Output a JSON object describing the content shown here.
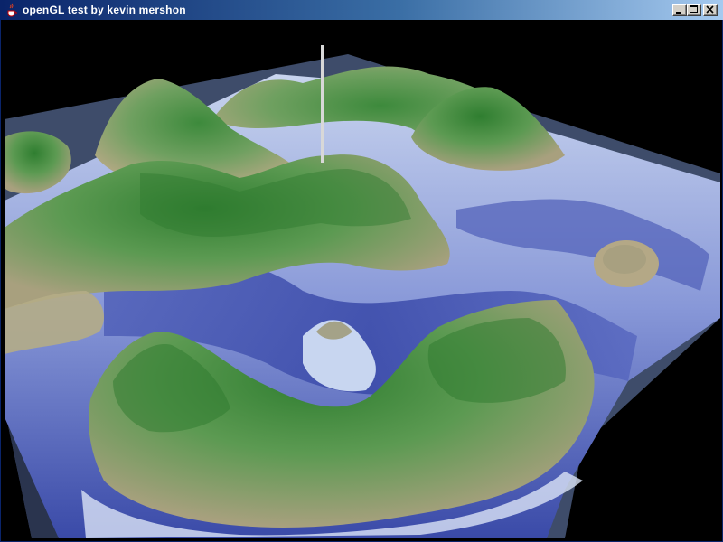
{
  "window": {
    "title": "openGL test by kevin mershon",
    "icon": "java-cup-icon",
    "controls": [
      "minimize-icon",
      "maximize-icon",
      "close-icon"
    ]
  },
  "scene": {
    "description_icon": "terrain-render",
    "colors": {
      "background": "#000000",
      "water_deep": "#3b4fb0",
      "water_shallow": "#b8c8f0",
      "land_low": "#a8a888",
      "land_high": "#3c8a3c",
      "table_edge": "#4a5a7a"
    }
  }
}
